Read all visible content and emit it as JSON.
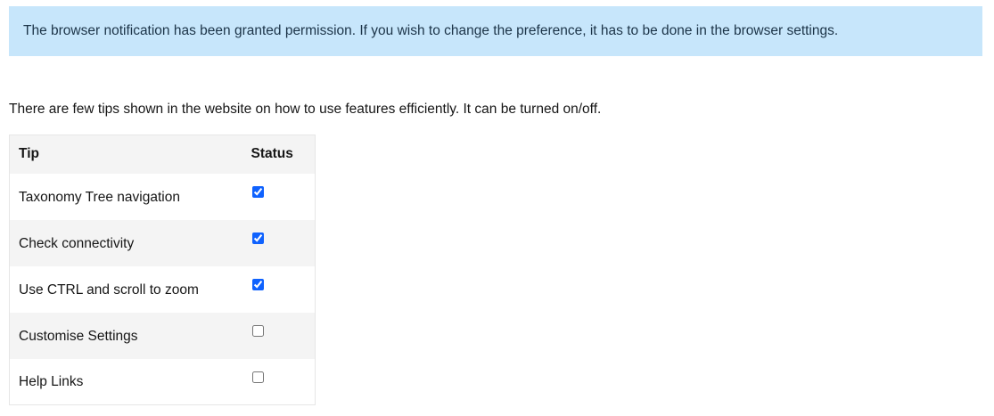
{
  "notice": {
    "text": "The browser notification has been granted permission. If you wish to change the preference, it has to be done in the browser settings."
  },
  "intro": {
    "text": "There are few tips shown in the website on how to use features efficiently. It can be turned on/off."
  },
  "table": {
    "headers": {
      "tip": "Tip",
      "status": "Status"
    },
    "rows": [
      {
        "label": "Taxonomy Tree navigation",
        "checked": true
      },
      {
        "label": "Check connectivity",
        "checked": true
      },
      {
        "label": "Use CTRL and scroll to zoom",
        "checked": true
      },
      {
        "label": "Customise Settings",
        "checked": false
      },
      {
        "label": "Help Links",
        "checked": false
      }
    ]
  },
  "colors": {
    "notice_bg": "#c7e6fb",
    "checkbox_accent": "#0f62fe",
    "row_stripe": "#f4f4f4"
  }
}
